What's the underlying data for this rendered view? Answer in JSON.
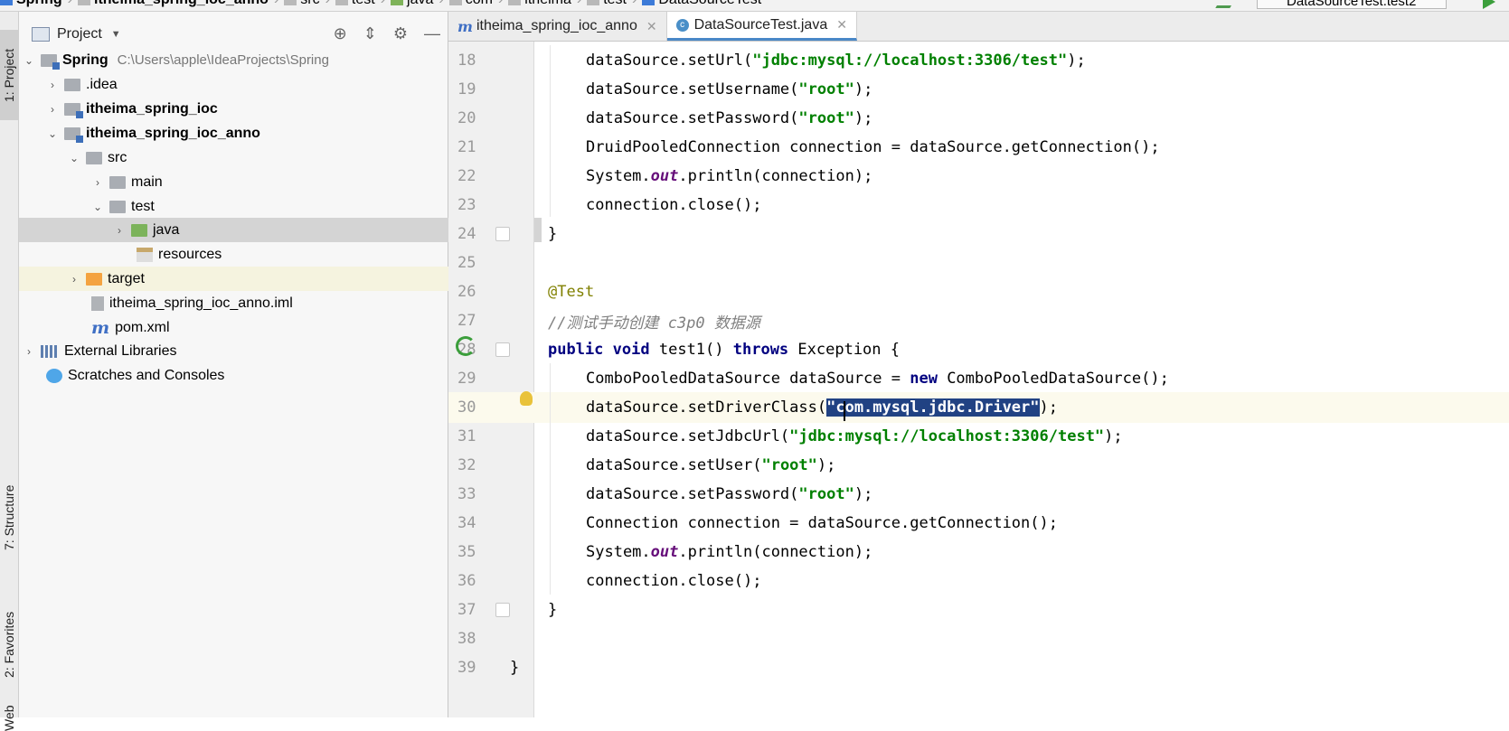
{
  "breadcrumb": [
    "Spring",
    "itheima_spring_ioc_anno",
    "src",
    "test",
    "java",
    "com",
    "itheima",
    "test",
    "DataSourceTest"
  ],
  "run_config": {
    "label": "DataSourceTest.test2"
  },
  "toolstrip": {
    "project": "1: Project",
    "structure": "7: Structure",
    "favorites": "2: Favorites",
    "web": "Web"
  },
  "project_panel": {
    "title": "Project",
    "root": {
      "name": "Spring",
      "path": "C:\\Users\\apple\\IdeaProjects\\Spring"
    },
    "items": {
      "idea": ".idea",
      "spring_ioc": "itheima_spring_ioc",
      "spring_ioc_anno": "itheima_spring_ioc_anno",
      "src": "src",
      "main": "main",
      "test": "test",
      "java": "java",
      "resources": "resources",
      "target": "target",
      "iml": "itheima_spring_ioc_anno.iml",
      "pom": "pom.xml",
      "external_libraries": "External Libraries",
      "scratches": "Scratches and Consoles"
    }
  },
  "editor_tabs": [
    {
      "label": "itheima_spring_ioc_anno"
    },
    {
      "label": "DataSourceTest.java"
    }
  ],
  "code": {
    "lines": [
      "18",
      "19",
      "20",
      "21",
      "22",
      "23",
      "24",
      "25",
      "26",
      "27",
      "28",
      "29",
      "30",
      "31",
      "32",
      "33",
      "34",
      "35",
      "36",
      "37",
      "38",
      "39"
    ],
    "l18": {
      "a": "dataSource.setUrl(",
      "s": "\"jdbc:mysql://localhost:3306/test\"",
      "b": ");"
    },
    "l19": {
      "a": "dataSource.setUsername(",
      "s": "\"root\"",
      "b": ");"
    },
    "l20": {
      "a": "dataSource.setPassword(",
      "s": "\"root\"",
      "b": ");"
    },
    "l21": {
      "a": "DruidPooledConnection connection = dataSource.getConnection();"
    },
    "l22": {
      "a": "System.",
      "st": "out",
      "b": ".println(connection);"
    },
    "l23": {
      "a": "connection.close();"
    },
    "l24": {
      "a": "}"
    },
    "l26": {
      "ann": "@Test"
    },
    "l27": {
      "cmt": "//测试手动创建 c3p0 数据源"
    },
    "l28": {
      "kw1": "public",
      "kw2": "void",
      "a": " test1() ",
      "kw3": "throws",
      "b": " Exception {"
    },
    "l29": {
      "a": "ComboPooledDataSource dataSource = ",
      "kw": "new",
      "b": " ComboPooledDataSource();"
    },
    "l30": {
      "a": "dataSource.setDriverClass(",
      "s": "\"com.mysql.jdbc.Driver\"",
      "b": ");"
    },
    "l31": {
      "a": "dataSource.setJdbcUrl(",
      "s": "\"jdbc:mysql://localhost:3306/test\"",
      "b": ");"
    },
    "l32": {
      "a": "dataSource.setUser(",
      "s": "\"root\"",
      "b": ");"
    },
    "l33": {
      "a": "dataSource.setPassword(",
      "s": "\"root\"",
      "b": ");"
    },
    "l34": {
      "a": "Connection connection = dataSource.getConnection();"
    },
    "l35": {
      "a": "System.",
      "st": "out",
      "b": ".println(connection);"
    },
    "l36": {
      "a": "connection.close();"
    },
    "l37": {
      "a": "}"
    },
    "l39": {
      "a": "}"
    }
  }
}
